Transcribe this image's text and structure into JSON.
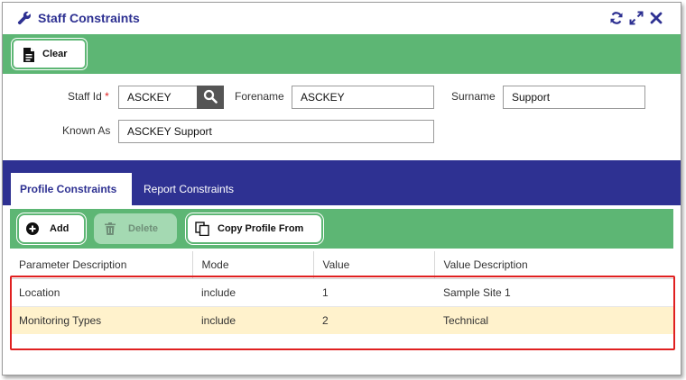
{
  "window": {
    "title": "Staff Constraints"
  },
  "toolbar": {
    "clear_label": "Clear"
  },
  "form": {
    "staff_id_label": "Staff Id",
    "required_mark": "*",
    "staff_id_value": "ASCKEY",
    "forename_label": "Forename",
    "forename_value": "ASCKEY",
    "surname_label": "Surname",
    "surname_value": "Support",
    "known_as_label": "Known As",
    "known_as_value": "ASCKEY Support"
  },
  "tabs": [
    {
      "label": "Profile Constraints",
      "active": true
    },
    {
      "label": "Report Constraints",
      "active": false
    }
  ],
  "actions": {
    "add_label": "Add",
    "delete_label": "Delete",
    "copy_label": "Copy Profile From"
  },
  "table": {
    "headers": [
      "Parameter Description",
      "Mode",
      "Value",
      "Value Description"
    ],
    "rows": [
      [
        "Location",
        "include",
        "1",
        "Sample Site 1"
      ],
      [
        "Monitoring Types",
        "include",
        "2",
        "Technical"
      ]
    ],
    "selected_row": 1
  },
  "colors": {
    "accent_green": "#5db674",
    "tab_bar_blue": "#2e3192",
    "selected_row": "#fff2cc",
    "highlight_red": "#e02020"
  },
  "icons": {
    "title": "wrench-icon",
    "refresh": "refresh-icon",
    "expand": "expand-icon",
    "close": "close-icon",
    "clear": "document-icon",
    "search": "search-icon",
    "add": "plus-circle-icon",
    "delete": "trash-icon",
    "copy": "copy-icon"
  }
}
